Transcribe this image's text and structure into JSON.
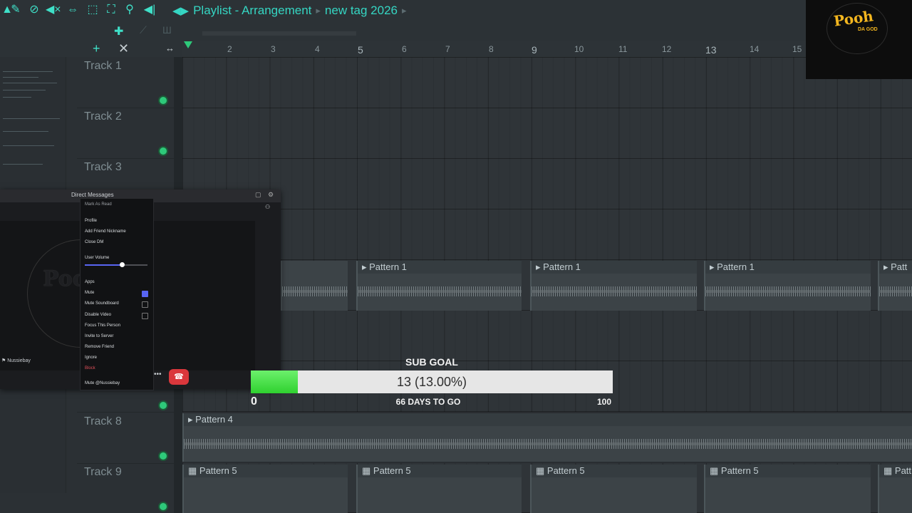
{
  "toolbar": {
    "icons": [
      "lock-icon",
      "magic-wand-icon",
      "no-entry-icon",
      "mute-icon",
      "slip-icon",
      "select-icon",
      "zoom-select-icon",
      "zoom-icon",
      "speaker-icon"
    ],
    "breadcrumb": {
      "window": "Playlist - Arrangement",
      "tag": "new tag 2026"
    }
  },
  "ruler": {
    "bars": [
      "2",
      "3",
      "4",
      "5",
      "6",
      "7",
      "8",
      "9",
      "10",
      "11",
      "12",
      "13",
      "14",
      "15"
    ]
  },
  "tracks": [
    {
      "label": "Track 1"
    },
    {
      "label": "Track 2"
    },
    {
      "label": "Track 3"
    },
    {
      "label": "Track 8"
    },
    {
      "label": "Track 9"
    }
  ],
  "clips": {
    "pattern1": "Pattern 1",
    "pattern4": "Pattern 4",
    "pattern5": "Pattern 5",
    "pattern_partial": "Patt"
  },
  "discord": {
    "title": "Direct Messages",
    "menu_header": "Mark As Read",
    "menu_items": [
      "Profile",
      "Add Friend Nickname",
      "Close DM",
      "User Volume",
      "Apps",
      "Mute",
      "Mute Soundboard",
      "Disable Video",
      "Focus This Person",
      "Invite to Server",
      "Remove Friend",
      "Ignore",
      "Block",
      "Mute @Nussiebay"
    ],
    "username": "Nussiebay"
  },
  "sub_goal": {
    "title": "SUB GOAL",
    "current": 13,
    "progress_text": "13 (13.00%)",
    "percent": 13.0,
    "min": "0",
    "max": "100",
    "days_text": "66 DAYS TO GO"
  },
  "logo": {
    "text": "Pooh",
    "sub": "DA GOD"
  },
  "colors": {
    "accent": "#35d6c3",
    "goal_fill": "#3fe03f",
    "track_led": "#2ec97a",
    "end_call": "#da373c"
  }
}
